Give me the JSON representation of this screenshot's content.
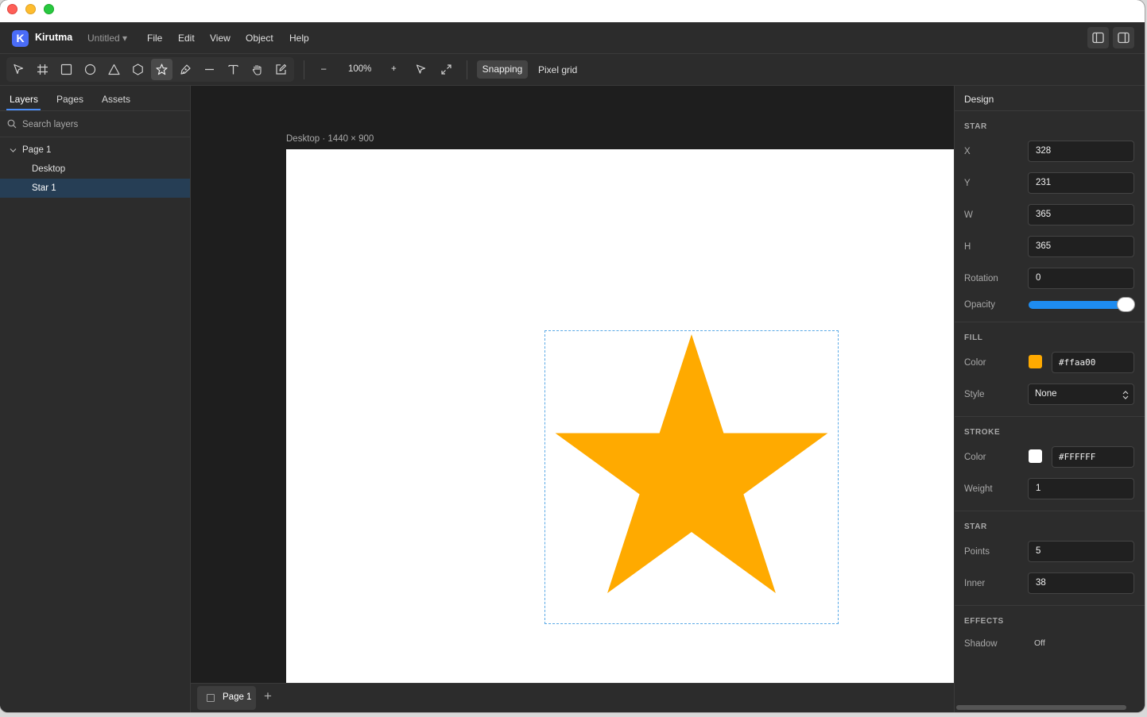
{
  "app": {
    "name": "Kirutma",
    "logo_letter": "K",
    "document": "Untitled ▾"
  },
  "menu": [
    "File",
    "Edit",
    "View",
    "Object",
    "Help"
  ],
  "toolbar": {
    "tools": [
      "select-pointer-icon",
      "frame-hash-icon",
      "rectangle-icon",
      "ellipse-icon",
      "triangle-icon",
      "polygon-icon",
      "star-icon",
      "pen-icon",
      "line-icon",
      "text-icon",
      "hand-icon",
      "image-edit-icon"
    ],
    "active_tool": "star-icon",
    "zoom_out": "–",
    "zoom_level": "100%",
    "zoom_in": "+",
    "snapping_label": "Snapping",
    "pixel_grid_label": "Pixel grid"
  },
  "left_panel": {
    "tabs": [
      {
        "label": "Layers"
      },
      {
        "label": "Pages"
      },
      {
        "label": "Assets"
      }
    ],
    "active_tab": "Layers",
    "search_placeholder": "Search layers",
    "layers": [
      {
        "label": "Page 1",
        "expanded": true
      },
      {
        "label": "Desktop"
      },
      {
        "label": "Star 1",
        "selected": true
      }
    ]
  },
  "canvas": {
    "frame_label": "Desktop · 1440 × 900",
    "star_color": "#ffaa00",
    "selection_color": "#5aa9e6"
  },
  "pages": {
    "tab_label": "Page 1",
    "add_label": "+"
  },
  "design_panel": {
    "title": "Design",
    "star_section": "STAR",
    "x_label": "X",
    "x": "328",
    "y_label": "Y",
    "y": "231",
    "w_label": "W",
    "w": "365",
    "h_label": "H",
    "h": "365",
    "rotation_label": "Rotation",
    "rotation": "0",
    "opacity_label": "Opacity",
    "opacity": 1.0,
    "fill_section": "FILL",
    "fill_color_label": "Color",
    "fill_color": "#ffaa00",
    "fill_style_label": "Style",
    "fill_style": "None",
    "stroke_section": "STROKE",
    "stroke_color_label": "Color",
    "stroke_color": "#FFFFFF",
    "stroke_weight_label": "Weight",
    "stroke_weight": "1",
    "star_props_section": "STAR",
    "points_label": "Points",
    "points": "5",
    "inner_label": "Inner",
    "inner": "38",
    "effects_section": "EFFECTS",
    "shadow_label": "Shadow",
    "shadow": "Off"
  }
}
